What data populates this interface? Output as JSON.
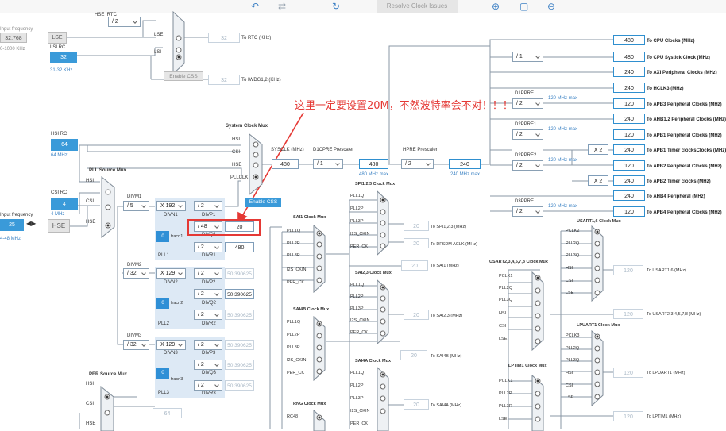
{
  "toolbar": {
    "resolve_label": "Resolve Clock Issues",
    "undo_icon": "undo-icon",
    "redo_icon": "redo-icon",
    "refresh_icon": "refresh-icon",
    "zoom_in_icon": "zoom-in-icon",
    "fit_icon": "fit-icon",
    "zoom_out_icon": "zoom-out-icon"
  },
  "left": {
    "input_freq_label": "Input frequency",
    "lse_value": "32.768",
    "lse_range": "0-1000 KHz",
    "lse_label": "LSE",
    "lsi_rc_label": "LSI RC",
    "lsi_value": "32",
    "lsi_range": "31-32 KHz",
    "hsi_rc_label": "HSI RC",
    "hsi_value": "64",
    "hsi_mhz": "64 MHz",
    "csi_rc_label": "CSI RC",
    "csi_value": "4",
    "csi_mhz": "4 MHz",
    "hse_input_label": "Input frequency",
    "hse_value": "25",
    "hse_range": "4-48 MHz",
    "hse_label": "HSE"
  },
  "rtc": {
    "div2": "/ 2",
    "lse": "LSE",
    "lsi": "LSI",
    "hse_rtc": "HSE_RTC",
    "rtc_value": "32",
    "rtc_label": "To RTC (KHz)",
    "iwdg_value": "32",
    "iwdg_label": "To IWDG1,2 (KHz)",
    "enable_css": "Enable CSS"
  },
  "sysmux": {
    "title": "System Clock Mux",
    "hsi": "HSI",
    "csi": "CSI",
    "hse": "HSE",
    "pllclk": "PLLCLK",
    "enable_css": "Enable CSS",
    "sysclk_label": "SYSCLK (MHz)",
    "sysclk_value": "480",
    "d1cpre_label": "D1CPRE Prescaler",
    "d1cpre": "/ 1",
    "d1_value": "480",
    "d1_max": "480 MHz max",
    "hpre_label": "HPRE Prescaler",
    "hpre": "/ 2",
    "hclk_value": "240",
    "hclk_max": "240 MHz max"
  },
  "pll": {
    "source_mux": "PLL Source Mux",
    "hsi": "HSI",
    "csi": "CSI",
    "hse": "HSE",
    "divm1_label": "DIVM1",
    "divm1": "/ 5",
    "divn1": "X 192",
    "divn1_label": "DIVN1",
    "divp1": "/ 2",
    "divp1_label": "DIVP1",
    "divq1": "/ 48",
    "divq1_label": "DIVQ1",
    "divq1_value": "20",
    "divr1": "/ 2",
    "divr1_label": "DIVR1",
    "divr1_value": "480",
    "frac1": "0",
    "frac1_label": "fracn1",
    "pll1": "PLL1",
    "divm2_label": "DIVM2",
    "divm2": "/ 32",
    "divn2": "X 129",
    "divn2_label": "DIVN2",
    "divp2": "/ 2",
    "divp2_label": "DIVP2",
    "divp2_value": "50.390625",
    "divq2": "/ 2",
    "divq2_label": "DIVQ2",
    "divq2_value": "50.390625",
    "divr2": "/ 2",
    "divr2_label": "DIVR2",
    "divr2_value": "50.390625",
    "frac2": "0",
    "frac2_label": "fracn2",
    "pll2": "PLL2",
    "divm3_label": "DIVM3",
    "divm3": "/ 32",
    "divn3": "X 129",
    "divn3_label": "DIVN3",
    "divp3": "/ 2",
    "divp3_label": "DIVP3",
    "divp3_value": "50.390625",
    "divq3": "/ 2",
    "divq3_label": "DIVQ3",
    "divq3_value": "50.390625",
    "divr3": "/ 2",
    "divr3_label": "DIVR3",
    "divr3_value": "50.390625",
    "frac3": "0",
    "frac3_label": "fracn3",
    "pll3": "PLL3"
  },
  "per": {
    "title": "PER Source Mux",
    "hsi": "HSI",
    "csi": "CSI",
    "hse": "HSE",
    "value": "64"
  },
  "sai1": {
    "title": "SAI1 Clock Mux",
    "in": [
      "PLL1Q",
      "PLL2P",
      "PLL3P",
      "I2S_CKIN",
      "PER_CK"
    ],
    "value": "20",
    "label": "To SAI1 (MHz)"
  },
  "spi": {
    "title": "SPI1,2,3 Clock Mux",
    "in": [
      "PLL1Q",
      "PLL2P",
      "PLL3P",
      "I2S_CKIN",
      "PER_CK"
    ],
    "value1": "20",
    "label1": "To SPI1,2,3 (MHz)",
    "value2": "20",
    "label2": "To DFSDM ACLK (MHz)"
  },
  "sai23": {
    "title": "SAI2,3 Clock Mux",
    "in": [
      "PLL1Q",
      "PLL2P",
      "PLL3P",
      "I2S_CKIN",
      "PER_CK"
    ],
    "value": "20",
    "label": "To SAI2,3 (MHz)"
  },
  "sai4a": {
    "title": "SAI4A Clock Mux",
    "in": [
      "PLL1Q",
      "PLL2P",
      "PLL3P",
      "I2S_CKIN",
      "PER_CK"
    ],
    "value": "20",
    "label": "To SAI4A (MHz)"
  },
  "sai4b": {
    "title": "SAI4B Clock Mux",
    "in": [
      "PLL1Q",
      "PLL2P",
      "PLL3P",
      "I2S_CKIN",
      "PER_CK"
    ],
    "value": "20",
    "label": "To SAI4B (MHz)"
  },
  "rng": {
    "title": "RNG Clock Mux",
    "in": [
      "RC48"
    ]
  },
  "usart1": {
    "title": "USART1,6 Clock Mux",
    "in": [
      "PCLK2",
      "PLL2Q",
      "PLL3Q",
      "HSI",
      "CSI",
      "LSE"
    ],
    "value": "120",
    "label": "To USART1,6 (MHz)"
  },
  "usart2": {
    "title": "USART2,3,4,5,7,8 Clock Mux",
    "in": [
      "PCLK1",
      "PLL2Q",
      "PLL3Q",
      "HSI",
      "CSI",
      "LSE"
    ],
    "value": "120",
    "label": "To USART2,3,4,5,7,8 (MHz)"
  },
  "lpuart": {
    "title": "LPUART1 Clock Mux",
    "in": [
      "PCLK3",
      "PLL2Q",
      "PLL3Q",
      "HSI",
      "CSI",
      "LSE"
    ],
    "value": "120",
    "label": "To LPUART1 (MHz)"
  },
  "lptim": {
    "title": "LPTIM1 Clock Mux",
    "in": [
      "PCLK1",
      "PLL2P",
      "PLL3R",
      "LSE"
    ],
    "value": "120",
    "label": "To LPTIM1 (MHz)"
  },
  "right": {
    "cpu_value": "480",
    "cpu_label": "To CPU Clocks (MHz)",
    "systick_div": "/ 1",
    "systick_value": "480",
    "systick_label": "To CPU Systick Clock (MHz)",
    "axi_value": "240",
    "axi_label": "To AXI Peripheral Clocks (MHz)",
    "hclk3_value": "240",
    "hclk3_label": "To HCLK3 (MHz)",
    "d1ppre_label": "D1PPRE",
    "d1ppre": "/ 2",
    "d1ppre_max": "120 MHz max",
    "apb3_value": "120",
    "apb3_label": "To APB3 Peripheral Clocks (MHz)",
    "ahb12_value": "240",
    "ahb12_label": "To AHB1,2 Peripheral Clocks (MHz)",
    "d2ppre1_label": "D2PPRE1",
    "d2ppre1": "/ 2",
    "d2ppre1_max": "120 MHz max",
    "apb1_value": "120",
    "apb1_label": "To APB1 Peripheral Clocks (MHz)",
    "x2a": "X 2",
    "apb1t_value": "240",
    "apb1t_label": "To APB1 Timer clocksClocks (MHz)",
    "d2ppre2_label": "D2PPRE2",
    "d2ppre2": "/ 2",
    "d2ppre2_max": "120 MHz max",
    "apb2_value": "120",
    "apb2_label": "To APB2 Peripheral Clocks (MHz)",
    "x2b": "X 2",
    "apb2t_value": "240",
    "apb2t_label": "To APB2 Timer clocks (MHz)",
    "ahb4_value": "240",
    "ahb4_label": "To AHB4 Peripheral (MHz)",
    "d3ppre_label": "D3PPRE",
    "d3ppre": "/ 2",
    "d3ppre_max": "120 MHz max",
    "apb4_value": "120",
    "apb4_label": "To APB4 Peripheral Clocks (MHz)"
  },
  "annotation": {
    "text": "这里一定要设置20M，不然波特率会不对！！！",
    "color": "#e53935"
  }
}
